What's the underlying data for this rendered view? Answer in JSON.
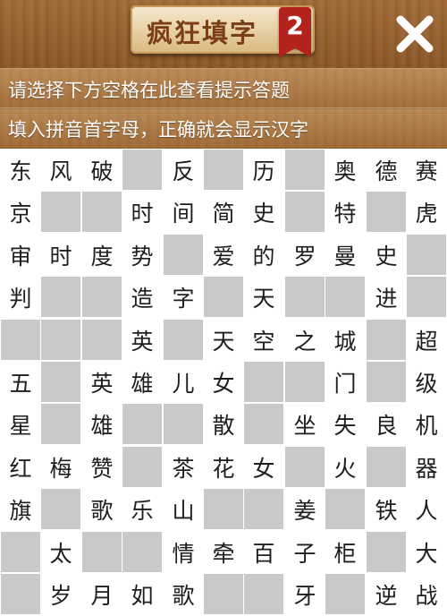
{
  "header": {
    "title": "疯狂填字",
    "level": "2"
  },
  "hints": [
    "请选择下方空格在此查看提示答题",
    "填入拼音首字母，正确就会显示汉字"
  ],
  "icons": {
    "close": "close-x-icon"
  },
  "colors": {
    "wood": "#9a6530",
    "banner": "#f0dfbd",
    "title_text": "#7a3f17",
    "badge_red": "#b3221c",
    "cell_filled": "#ffffff",
    "cell_blank": "#c9c9c9"
  },
  "grid": {
    "rows": [
      [
        "东",
        "风",
        "破",
        "",
        "反",
        "",
        "历",
        "",
        "奥",
        "德",
        "赛"
      ],
      [
        "京",
        "",
        "",
        "时",
        "间",
        "简",
        "史",
        "",
        "特",
        "",
        "虎"
      ],
      [
        "审",
        "时",
        "度",
        "势",
        "",
        "爱",
        "的",
        "罗",
        "曼",
        "史",
        ""
      ],
      [
        "判",
        "",
        "",
        "造",
        "字",
        "",
        "天",
        "",
        "",
        "进",
        ""
      ],
      [
        "",
        "",
        "",
        "英",
        "",
        "天",
        "空",
        "之",
        "城",
        "",
        "超"
      ],
      [
        "五",
        "",
        "英",
        "雄",
        "儿",
        "女",
        "",
        "",
        "门",
        "",
        "级"
      ],
      [
        "星",
        "",
        "雄",
        "",
        "",
        "散",
        "",
        "坐",
        "失",
        "良",
        "机"
      ],
      [
        "红",
        "梅",
        "赞",
        "",
        "茶",
        "花",
        "女",
        "",
        "火",
        "",
        "器"
      ],
      [
        "旗",
        "",
        "歌",
        "乐",
        "山",
        "",
        "",
        "姜",
        "",
        "铁",
        "人"
      ],
      [
        "",
        "太",
        "",
        "",
        "情",
        "牵",
        "百",
        "子",
        "柜",
        "",
        "大"
      ],
      [
        "",
        "岁",
        "月",
        "如",
        "歌",
        "",
        "",
        "牙",
        "",
        "逆",
        "战"
      ]
    ]
  }
}
